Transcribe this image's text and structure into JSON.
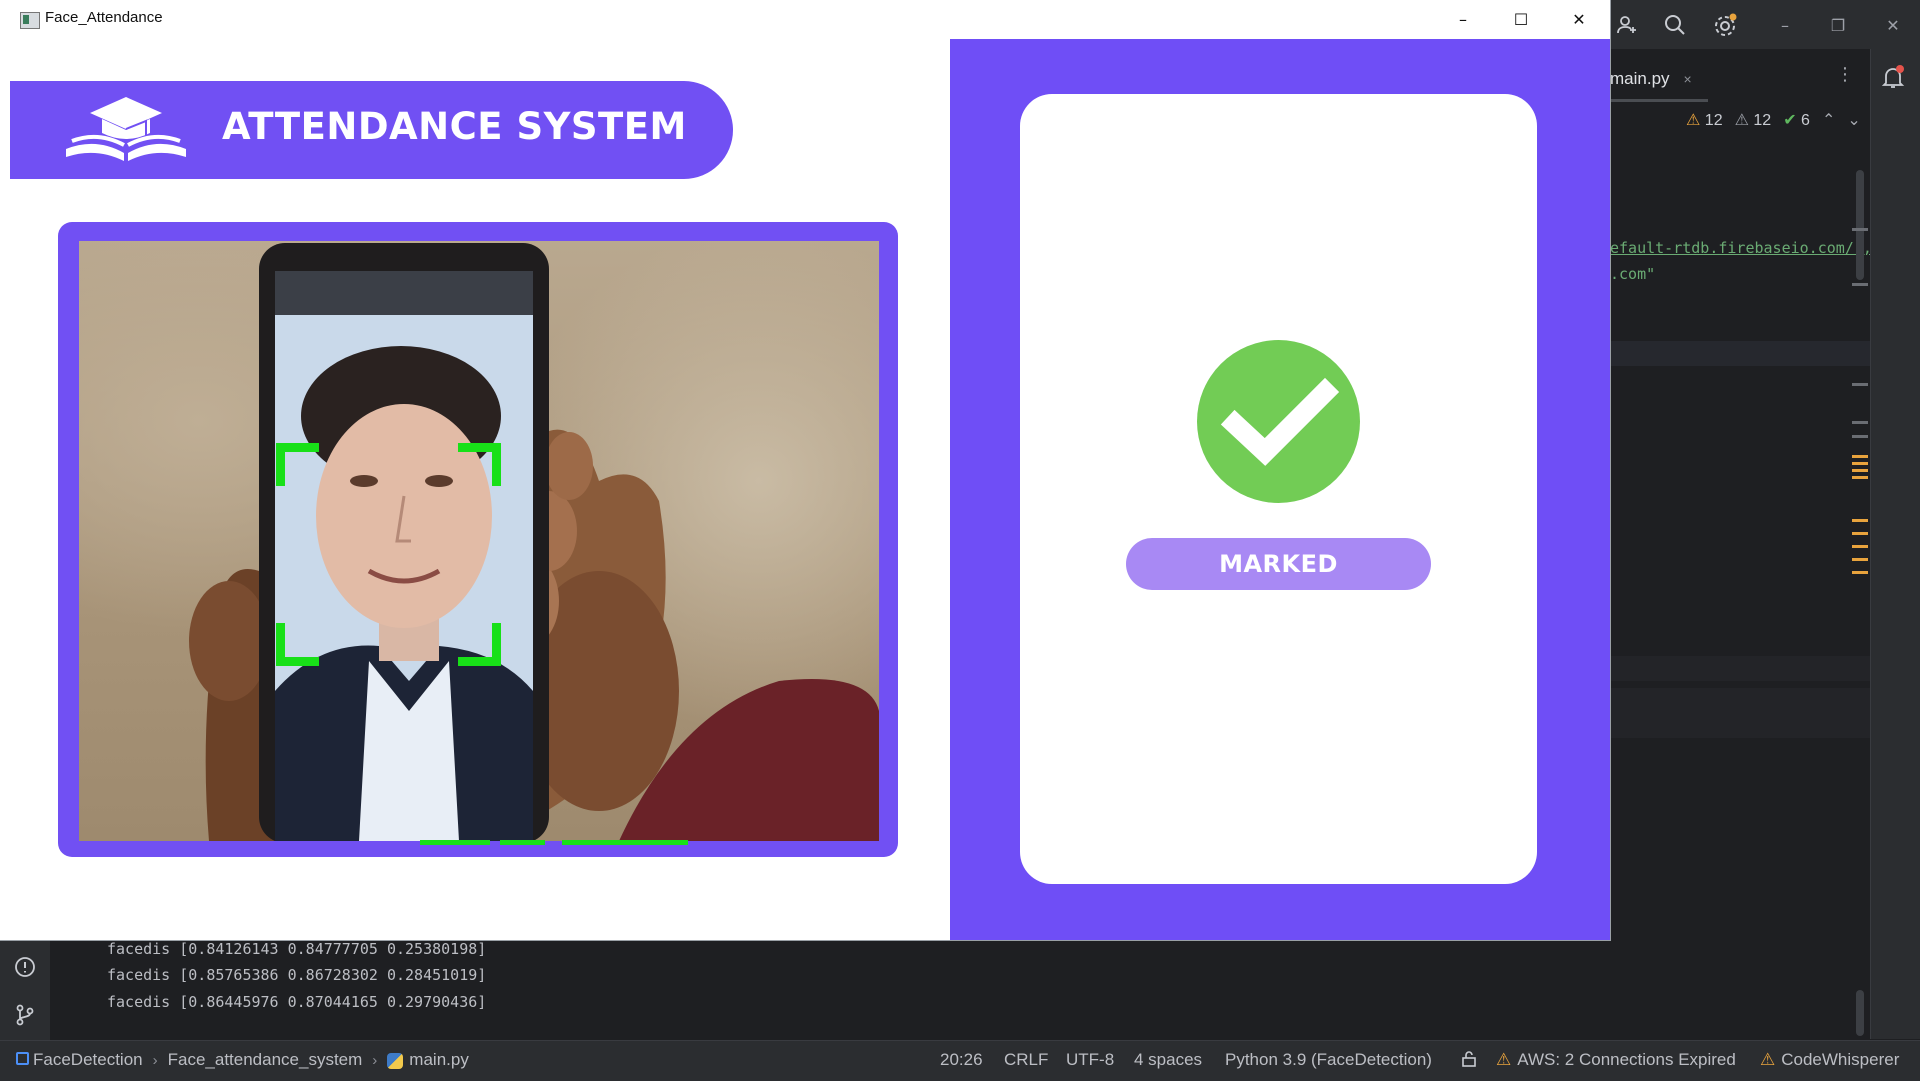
{
  "window": {
    "title": "Face_Attendance",
    "minimize_glyph": "–",
    "maximize_glyph": "☐",
    "close_glyph": "✕"
  },
  "header": {
    "title": "ATTENDANCE SYSTEM",
    "logo_icon": "graduation-book-icon"
  },
  "status_card": {
    "icon": "check-circle-icon",
    "label": "MARKED",
    "accent_color": "#72cc55"
  },
  "colors": {
    "brand": "#7150f3",
    "panel": "#6f4ef6",
    "badge": "#a889f4",
    "face_box": "#18e018"
  },
  "ide": {
    "tab": {
      "label": "main.py",
      "close": "×"
    },
    "inspections": {
      "warnings": "12",
      "weak_warnings": "12",
      "ok": "6"
    },
    "code_fragments": [
      "efault-rtdb.firebaseio.com/',",
      ".com\""
    ],
    "console_lines": [
      "facedis [0.84126143 0.84777705 0.25380198]",
      "facedis [0.85765386 0.86728302 0.28451019]",
      "facedis [0.86445976 0.87044165 0.29790436]"
    ],
    "breadcrumbs": [
      "FaceDetection",
      "Face_attendance_system",
      "main.py"
    ],
    "status": {
      "position": "20:26",
      "line_sep": "CRLF",
      "encoding": "UTF-8",
      "indent": "4 spaces",
      "interpreter": "Python 3.9 (FaceDetection)",
      "aws": "AWS: 2 Connections Expired",
      "codewhisperer": "CodeWhisperer"
    }
  }
}
